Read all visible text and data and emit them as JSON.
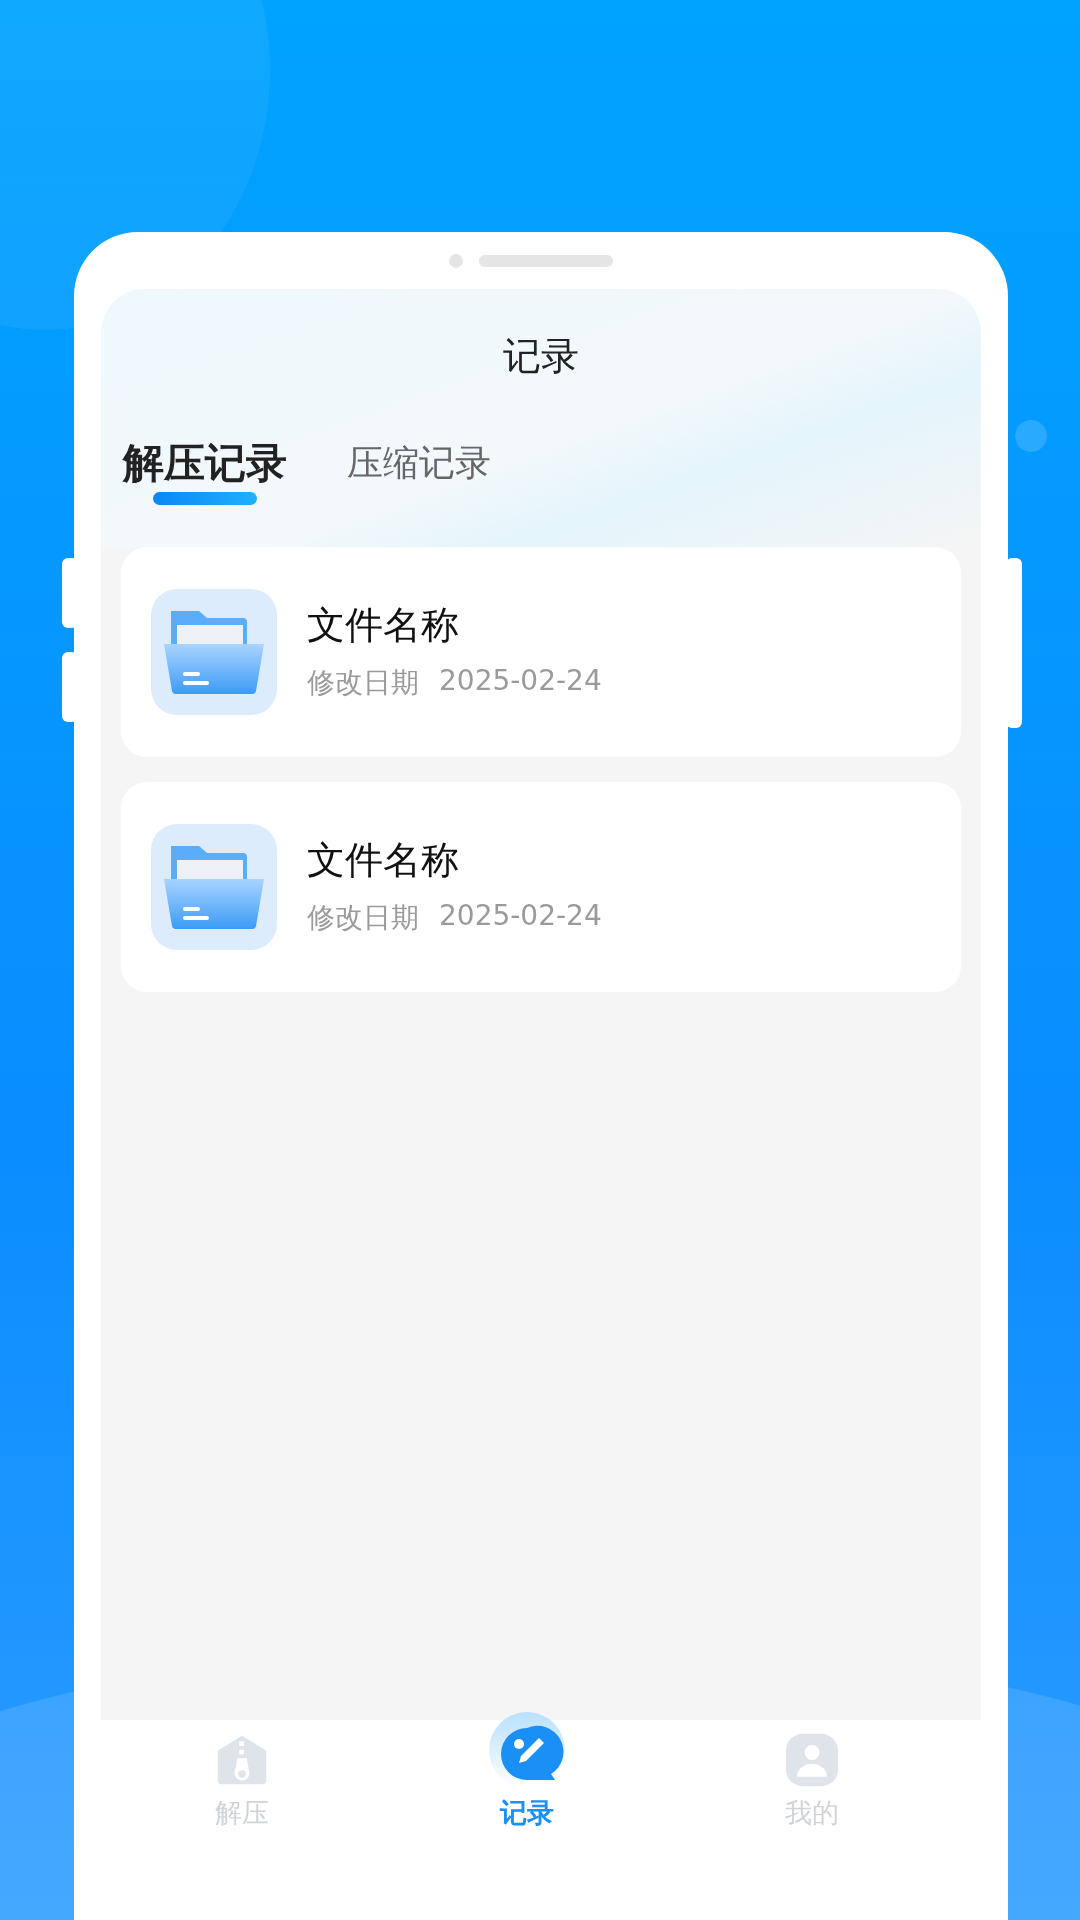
{
  "header": {
    "title": "记录"
  },
  "tabs": [
    {
      "label": "解压记录",
      "selected": true
    },
    {
      "label": "压缩记录",
      "selected": false
    }
  ],
  "files": [
    {
      "name": "文件名称",
      "date_label": "修改日期",
      "date": "2025-02-24"
    },
    {
      "name": "文件名称",
      "date_label": "修改日期",
      "date": "2025-02-24"
    }
  ],
  "nav": [
    {
      "kind": "unzip",
      "label": "解压",
      "selected": false
    },
    {
      "kind": "records",
      "label": "记录",
      "selected": true
    },
    {
      "kind": "profile",
      "label": "我的",
      "selected": false
    }
  ]
}
